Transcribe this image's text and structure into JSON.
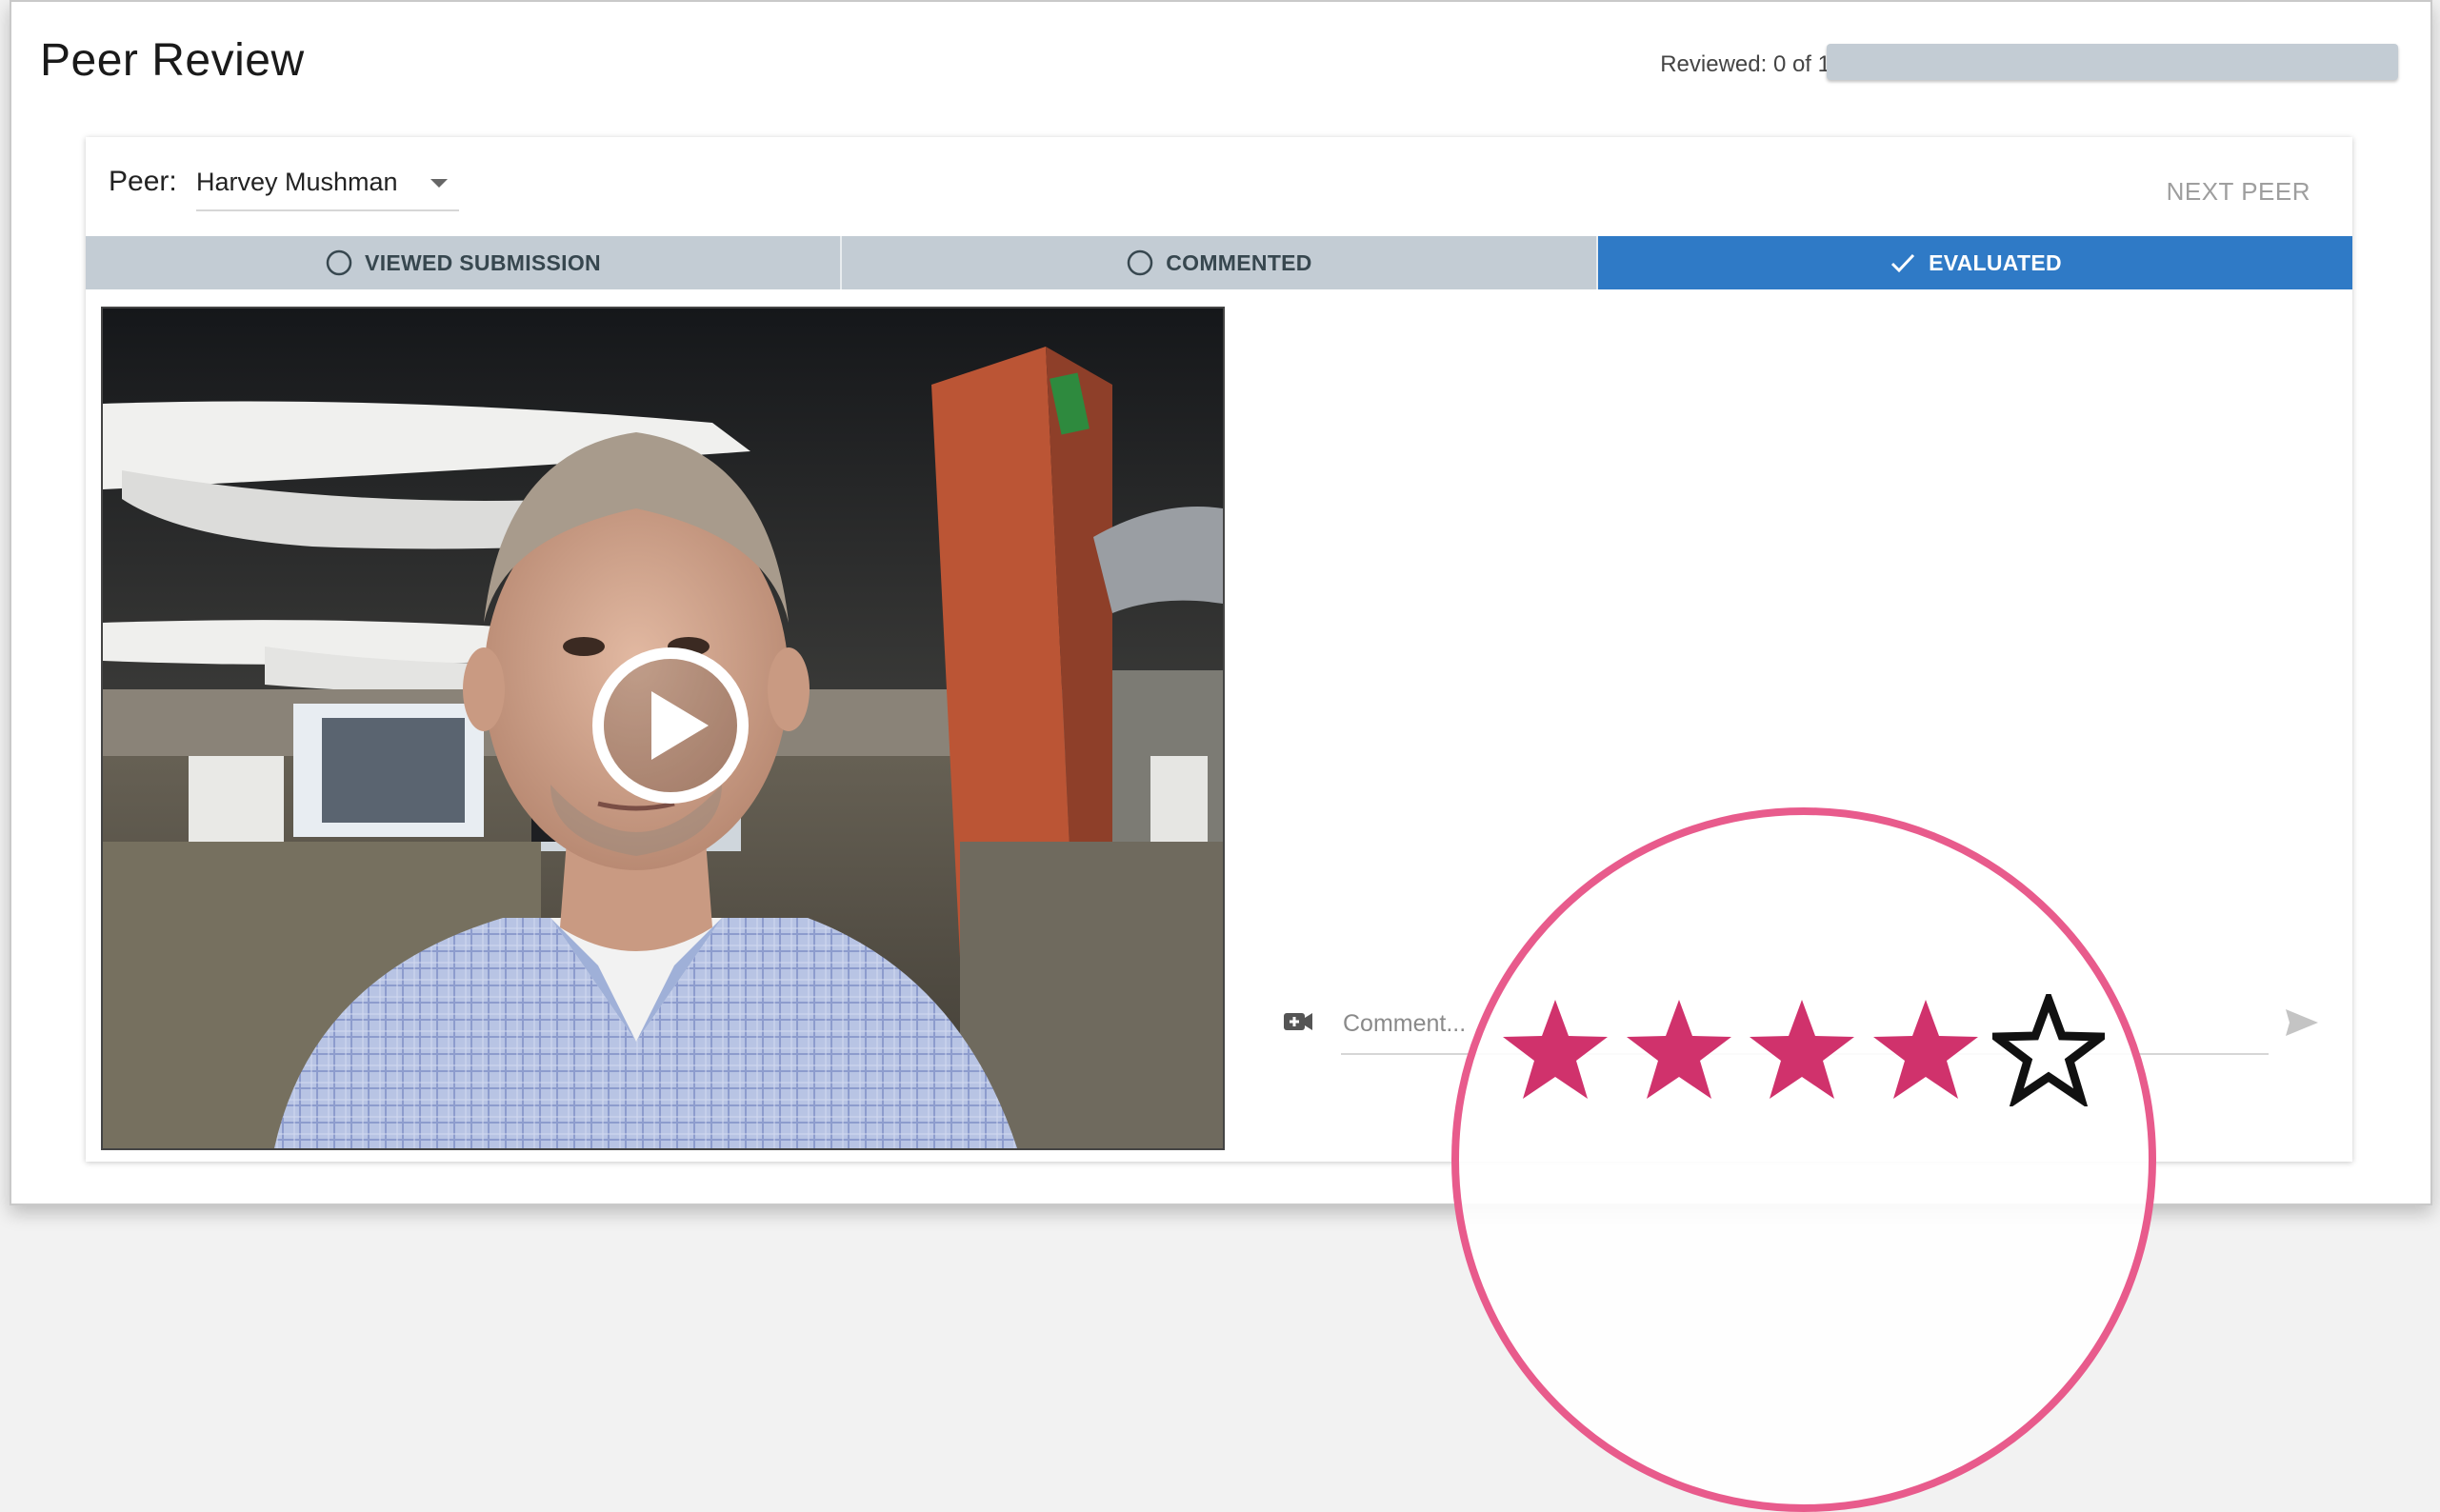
{
  "app": {
    "title": "Peer Review"
  },
  "progress": {
    "label": "Reviewed: 0 of 1",
    "reviewed": 0,
    "total": 1,
    "fraction": 0
  },
  "peer": {
    "label": "Peer:",
    "name": "Harvey Mushman",
    "next_label": "NEXT PEER"
  },
  "steps": [
    {
      "label": "VIEWED SUBMISSION",
      "state": "incomplete",
      "icon": "circle-outline-icon"
    },
    {
      "label": "COMMENTED",
      "state": "incomplete",
      "icon": "circle-outline-icon"
    },
    {
      "label": "EVALUATED",
      "state": "complete",
      "icon": "check-icon"
    }
  ],
  "video": {
    "play_icon": "play-icon"
  },
  "comment": {
    "placeholder": "Comment...",
    "value": "",
    "video_icon": "video-comment-icon",
    "send_icon": "send-icon"
  },
  "rating": {
    "value": 4,
    "max": 5,
    "filled_color": "#d0326c",
    "empty_color": "#111111"
  },
  "colors": {
    "accent": "#2f7ac6",
    "step_inactive": "#c3ccd4",
    "highlight": "#e85b8c"
  }
}
